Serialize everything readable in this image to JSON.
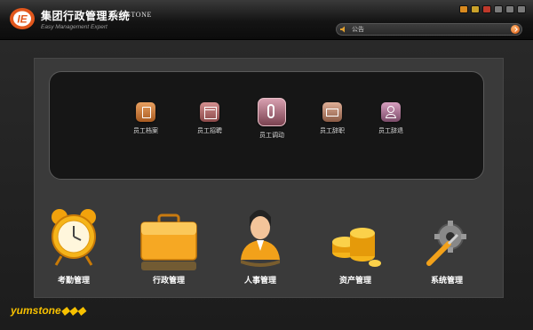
{
  "window": {
    "title_cn": "集团行政管理系统",
    "title_en": "BOSSTONE",
    "subtitle": "Easy Management Expert",
    "logo_text": "IE"
  },
  "window_controls": [
    {
      "name": "skin",
      "icon": "skin-icon",
      "color": "#d98a1f"
    },
    {
      "name": "settings",
      "icon": "settings-icon",
      "color": "#c9a12a"
    },
    {
      "name": "help",
      "icon": "help-icon",
      "color": "#c0392b"
    },
    {
      "name": "minimize",
      "icon": "minimize-icon",
      "color": "#7a7a7a"
    },
    {
      "name": "maximize",
      "icon": "maximize-icon",
      "color": "#7a7a7a"
    },
    {
      "name": "close",
      "icon": "close-icon",
      "color": "#7a7a7a"
    }
  ],
  "search": {
    "placeholder": "公告",
    "icon": "speaker-icon"
  },
  "submenu": [
    {
      "id": "emp-file",
      "label": "员工档案",
      "icon": "file-icon",
      "color": "#c8783a"
    },
    {
      "id": "emp-recruit",
      "label": "员工招聘",
      "icon": "calendar-icon",
      "color": "#b06a6a"
    },
    {
      "id": "emp-transfer",
      "label": "员工调动",
      "icon": "transfer-icon",
      "color": "#b07a88",
      "selected": true
    },
    {
      "id": "emp-resign",
      "label": "员工辞职",
      "icon": "mail-icon",
      "color": "#b98a74"
    },
    {
      "id": "emp-dismiss",
      "label": "员工辞退",
      "icon": "person-icon",
      "color": "#b07a9a"
    }
  ],
  "modules": [
    {
      "id": "attendance",
      "label": "考勤管理",
      "icon": "alarm-clock-icon"
    },
    {
      "id": "admin",
      "label": "行政管理",
      "icon": "briefcase-icon"
    },
    {
      "id": "hr",
      "label": "人事管理",
      "icon": "person-icon"
    },
    {
      "id": "assets",
      "label": "资产管理",
      "icon": "coins-icon"
    },
    {
      "id": "system",
      "label": "系统管理",
      "icon": "tools-icon"
    }
  ],
  "footer": {
    "brand": "yumstone",
    "brand_suffix": "◆◆◆"
  }
}
